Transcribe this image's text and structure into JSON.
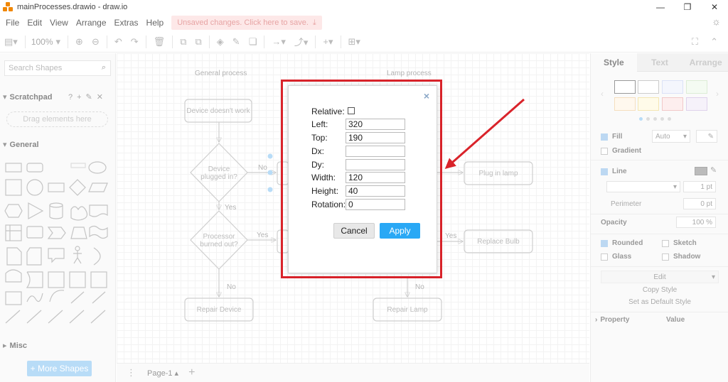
{
  "window": {
    "title": "mainProcesses.drawio - draw.io",
    "minimize": "—",
    "restore": "❐",
    "close": "✕"
  },
  "menu": {
    "items": [
      "File",
      "Edit",
      "View",
      "Arrange",
      "Extras",
      "Help"
    ],
    "unsaved": "Unsaved changes. Click here to save."
  },
  "toolbar": {
    "zoom": "100%"
  },
  "sidebar": {
    "search_placeholder": "Search Shapes",
    "scratchpad_title": "Scratchpad",
    "scratchpad_drop": "Drag elements here",
    "general_title": "General",
    "misc_title": "Misc",
    "more_shapes": "+ More Shapes"
  },
  "diagram": {
    "general_title": "General process",
    "lamp_title": "Lamp process",
    "nodes": {
      "device_doesnt_work": "Device doesn't work",
      "device_plugged_1": "Device",
      "device_plugged_2": "plugged in?",
      "processor_1": "Processor",
      "processor_2": "burned out?",
      "repair_device": "Repair Device",
      "plug_in_lamp": "Plug in lamp",
      "replace_bulb": "Replace Bulb",
      "repair_lamp": "Repair Lamp"
    },
    "edges": {
      "no": "No",
      "yes": "Yes"
    }
  },
  "bottombar": {
    "page_tab": "Page-1",
    "add_page": "+"
  },
  "panel": {
    "tabs": [
      "Style",
      "Text",
      "Arrange"
    ],
    "fill_label": "Fill",
    "fill_value": "Auto",
    "gradient_label": "Gradient",
    "line_label": "Line",
    "line_width": "1 pt",
    "perimeter_label": "Perimeter",
    "perimeter_value": "0 pt",
    "opacity_label": "Opacity",
    "opacity_value": "100 %",
    "rounded_label": "Rounded",
    "sketch_label": "Sketch",
    "glass_label": "Glass",
    "shadow_label": "Shadow",
    "edit_btn": "Edit",
    "copy_style_btn": "Copy Style",
    "default_style_btn": "Set as Default Style",
    "property_col": "Property",
    "value_col": "Value"
  },
  "dialog": {
    "close": "×",
    "relative_label": "Relative:",
    "left_label": "Left:",
    "left_value": "320",
    "top_label": "Top:",
    "top_value": "190",
    "dx_label": "Dx:",
    "dx_value": "",
    "dy_label": "Dy:",
    "dy_value": "",
    "width_label": "Width:",
    "width_value": "120",
    "height_label": "Height:",
    "height_value": "40",
    "rotation_label": "Rotation:",
    "rotation_value": "0",
    "cancel": "Cancel",
    "apply": "Apply"
  },
  "colors": {
    "highlight": "#d9232a",
    "apply_button": "#29a8f5",
    "logo": "#f08705"
  }
}
